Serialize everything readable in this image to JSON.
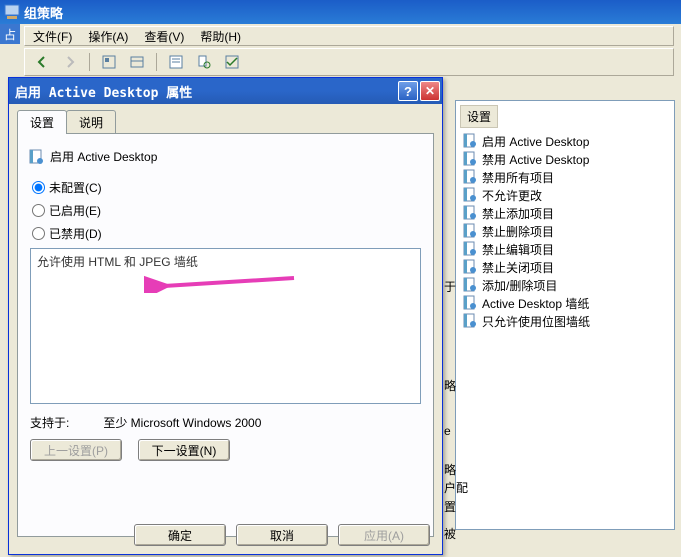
{
  "app": {
    "title": "组策略",
    "left_strip": "占"
  },
  "menubar": {
    "file": "文件(F)",
    "action": "操作(A)",
    "view": "查看(V)",
    "help": "帮助(H)"
  },
  "right_pane": {
    "header": "设置",
    "items": [
      "启用 Active Desktop",
      "禁用 Active Desktop",
      "禁用所有项目",
      "不允许更改",
      "禁止添加项目",
      "禁止删除项目",
      "禁止编辑项目",
      "禁止关闭项目",
      "添加/删除项目",
      "Active Desktop 墙纸",
      "只允许使用位图墙纸"
    ]
  },
  "mid_labels": {
    "yu": "于",
    "ie": "e",
    "lue": "略",
    "hupei": "户配",
    "zhi": "置",
    "bei": "被"
  },
  "dialog": {
    "title": "启用 Active Desktop 属性",
    "tabs": {
      "settings": "设置",
      "explain": "说明"
    },
    "policy_name": "启用 Active Desktop",
    "radios": {
      "not_configured": "未配置(C)",
      "enabled": "已启用(E)",
      "disabled": "已禁用(D)"
    },
    "description": "允许使用 HTML 和 JPEG 墙纸",
    "supported_label": "支持于:",
    "supported_value": "至少 Microsoft Windows 2000",
    "prev_btn": "上一设置(P)",
    "next_btn": "下一设置(N)",
    "ok": "确定",
    "cancel": "取消",
    "apply": "应用(A)"
  }
}
